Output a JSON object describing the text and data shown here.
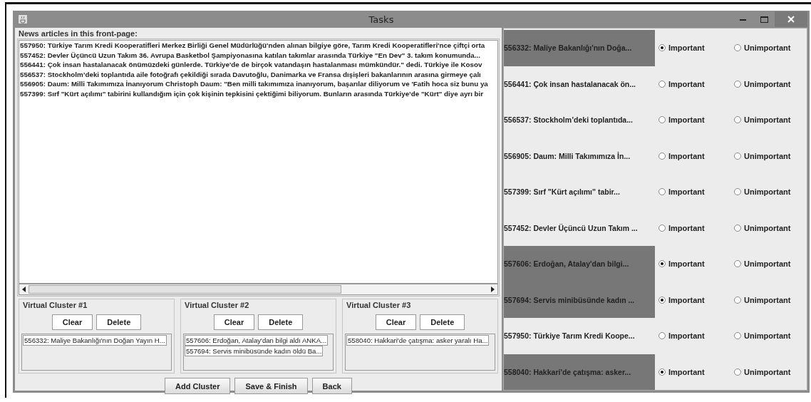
{
  "window": {
    "title": "Tasks"
  },
  "articles": {
    "title": "News articles in this front-page:",
    "items": [
      "557950: Türkiye Tarım Kredi Kooperatifleri Merkez Birliği Genel Müdürlüğü'nden alınan bilgiye göre, Tarım Kredi Kooperatifleri'nce çiftçi orta",
      "557452: Devler Üçüncü Uzun Takım 36. Avrupa Basketbol Şampiyonasına katılan takımlar arasında Türkiye \"En Dev\" 3. takım konumunda...",
      "556441: Çok insan hastalanacak önümüzdeki günlerde. Türkiye'de de birçok vatandaşın hastalanması mümkündür.\" dedi. Türkiye ile Kosov",
      "556537: Stockholm’deki toplantıda aile fotoğrafı çekildiği sırada Davutoğlu, Danimarka ve Fransa dışişleri bakanlarının arasına girmeye çalı",
      "556905: Daum: Milli Takımımıza İnanıyorum Christoph Daum: \"Ben milli takımımıza inanıyorum, başarılar diliyorum ve 'Fatih hoca siz bunu ya",
      "557399: Sırf \"Kürt açılımı\" tabirini kullandığım için çok kişinin tepkisini çektiğimi biliyorum. Bunların arasında Türkiye’de \"Kürt\" diye ayrı bir"
    ]
  },
  "clusters": [
    {
      "title": "Virtual Cluster #1",
      "buttons": [
        "Clear",
        "Delete"
      ],
      "items": [
        "556332: Maliye Bakanlığı'nın Doğan Yayın H..."
      ]
    },
    {
      "title": "Virtual Cluster #2",
      "buttons": [
        "Clear",
        "Delete"
      ],
      "items": [
        "557606: Erdoğan, Atalay'dan bilgi aldı ANKA...",
        "557694: Servis minibüsünde kadın öldü  Ba..."
      ]
    },
    {
      "title": "Virtual Cluster #3",
      "buttons": [
        "Clear",
        "Delete"
      ],
      "items": [
        "558040: Hakkari'de çatışma: asker yaralı Ha..."
      ]
    }
  ],
  "buttons": [
    "Add Cluster",
    "Save & Finish",
    "Back"
  ],
  "ratings": [
    {
      "label": "556332: Maliye Bakanlığı'nın Doğa...",
      "options": [
        {
          "label": "Important",
          "selected": true
        },
        {
          "label": "Unimportant",
          "selected": false
        }
      ]
    },
    {
      "label": "556441: Çok insan hastalanacak ön...",
      "options": [
        {
          "label": "Important",
          "selected": false
        },
        {
          "label": "Unimportant",
          "selected": false
        }
      ]
    },
    {
      "label": "556537: Stockholm’deki toplantıda...",
      "options": [
        {
          "label": "Important",
          "selected": false
        },
        {
          "label": "Unimportant",
          "selected": false
        }
      ]
    },
    {
      "label": "556905: Daum: Milli Takımımıza İn...",
      "options": [
        {
          "label": "Important",
          "selected": false
        },
        {
          "label": "Unimportant",
          "selected": false
        }
      ]
    },
    {
      "label": "557399: Sırf \"Kürt açılımı\" tabir...",
      "options": [
        {
          "label": "Important",
          "selected": false
        },
        {
          "label": "Unimportant",
          "selected": false
        }
      ]
    },
    {
      "label": "557452: Devler Üçüncü Uzun Takım ...",
      "options": [
        {
          "label": "Important",
          "selected": false
        },
        {
          "label": "Unimportant",
          "selected": false
        }
      ]
    },
    {
      "label": "557606: Erdoğan, Atalay'dan bilgi...",
      "options": [
        {
          "label": "Important",
          "selected": true
        },
        {
          "label": "Unimportant",
          "selected": false
        }
      ]
    },
    {
      "label": "557694: Servis minibüsünde kadın ...",
      "options": [
        {
          "label": "Important",
          "selected": true
        },
        {
          "label": "Unimportant",
          "selected": false
        }
      ]
    },
    {
      "label": "557950: Türkiye Tarım Kredi Koope...",
      "options": [
        {
          "label": "Important",
          "selected": false
        },
        {
          "label": "Unimportant",
          "selected": false
        }
      ]
    },
    {
      "label": "558040: Hakkari'de çatışma: asker...",
      "options": [
        {
          "label": "Important",
          "selected": true
        },
        {
          "label": "Unimportant",
          "selected": false
        }
      ]
    }
  ]
}
